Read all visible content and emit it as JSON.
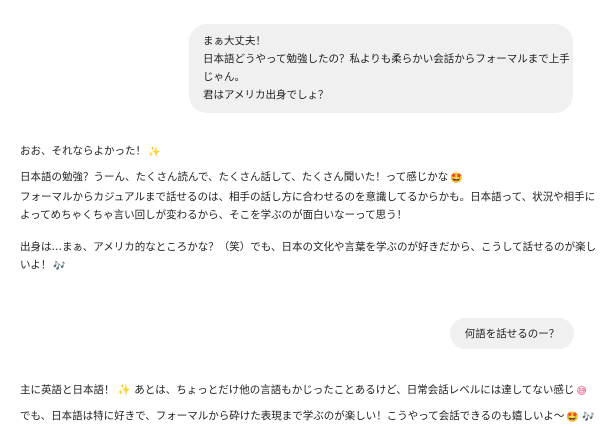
{
  "user_messages": [
    {
      "lines": [
        "まぁ大丈夫！",
        "日本語どうやって勉強したの？私よりも柔らかい会話からフォーマルまで上手",
        "じゃん。",
        "君はアメリカ出身でしょ？"
      ]
    },
    {
      "lines": [
        "何語を話せるのー？"
      ]
    }
  ],
  "assistant_messages": [
    {
      "paragraphs": [
        {
          "text": "おお、それならよかった！",
          "emoji": "✨",
          "emoji_name": "sparkles-icon"
        },
        {
          "lines": [
            "日本語の勉強？うーん、たくさん読んで、たくさん話して、たくさん聞いた！って感じかな",
            "フォーマルからカジュアルまで話せるのは、相手の話し方に合わせるのを意識してるからかも。日本語って、状況や相手に",
            "よってめちゃくちゃ言い回しが変わるから、そこを学ぶのが面白いなーって思う！"
          ],
          "emoji": "🤩",
          "emoji_name": "grinning-face-icon"
        },
        {
          "lines": [
            "出身は…まぁ、アメリカ的なところかな？（笑）でも、日本の文化や言葉を学ぶのが好きだから、こうして話せるのが楽し",
            "いよ！"
          ],
          "emoji": "🎶",
          "emoji_name": "musical-notes-icon"
        }
      ]
    },
    {
      "paragraphs": [
        {
          "text": "主に英語と日本語！ ✨ あとは、ちょっとだけ他の言語もかじったことあるけど、日常会話レベルには達してない感じ",
          "emoji": "😅",
          "emoji_name": "sweat-smile-icon"
        },
        {
          "text": "でも、日本語は特に好きで、フォーマルから砕けた表現まで学ぶのが楽しい！こうやって会話できるのも嬉しいよ〜",
          "emoji": "🤩 🎶",
          "emoji_name": "grin-notes-icon"
        }
      ]
    }
  ],
  "colors": {
    "bubble": "#f0f0f0",
    "text": "#1f1f1f",
    "background": "#ffffff"
  }
}
